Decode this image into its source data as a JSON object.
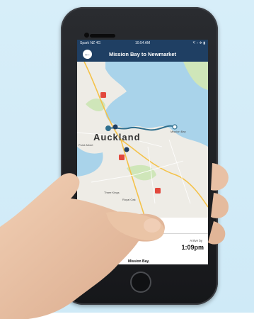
{
  "status_bar": {
    "carrier": "Spark NZ  4G",
    "time": "10:54 AM",
    "indicators": "↸ ↑ ✲ ▮"
  },
  "header": {
    "title": "Mission Bay to Newmarket",
    "back_icon": "back-arrow-icon"
  },
  "map": {
    "city": "Auckland",
    "places": {
      "mission_bay": "Mission Bay",
      "west": "Point Albert",
      "three_kings": "Three Kings",
      "royal_oak": "Royal Oak"
    },
    "route_color": "#2f6f8e",
    "water_color": "#a9d3ea",
    "land_color": "#eeece6",
    "park_color": "#cfe6b9",
    "highway_badges": [
      "1",
      "1",
      "1"
    ]
  },
  "trip": {
    "arrive_label": "Arrive by",
    "arrive_time": "1:09pm",
    "destination": "Mission Bay,"
  },
  "colors": {
    "nav_bar": "#1f3f63",
    "background": "#d7eef9"
  }
}
